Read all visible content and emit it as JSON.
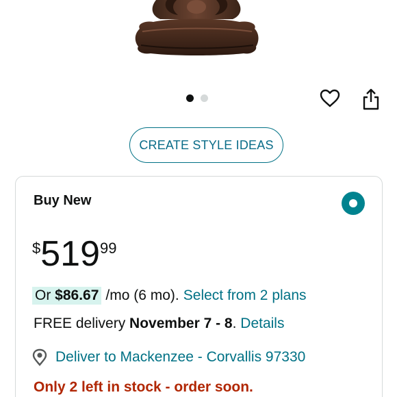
{
  "product": {
    "image_icon": "lamp-base-image"
  },
  "carousel": {
    "total_dots": 2,
    "active_index": 0
  },
  "actions": {
    "heart_icon": "heart-icon",
    "share_icon": "share-icon"
  },
  "style_button": {
    "label": "CREATE STYLE IDEAS"
  },
  "buy_box": {
    "title": "Buy New",
    "price": {
      "symbol": "$",
      "whole": "519",
      "fraction": "99"
    },
    "monthly": {
      "prefix": "Or ",
      "amount": "$86.67",
      "term": "/mo (6 mo).",
      "plans_link": "Select from 2 plans"
    },
    "delivery": {
      "prefix": "FREE delivery ",
      "date": "November 7 - 8",
      "suffix": ". ",
      "details_link": "Details"
    },
    "location": {
      "text": "Deliver to Mackenzee - Corvallis 97330",
      "icon": "location-pin-icon"
    },
    "stock": "Only 2 left in stock - order soon."
  },
  "colors": {
    "link": "#007185",
    "accent_teal": "#00838f",
    "stock_red": "#b12704",
    "highlight": "#d7f3ee"
  }
}
